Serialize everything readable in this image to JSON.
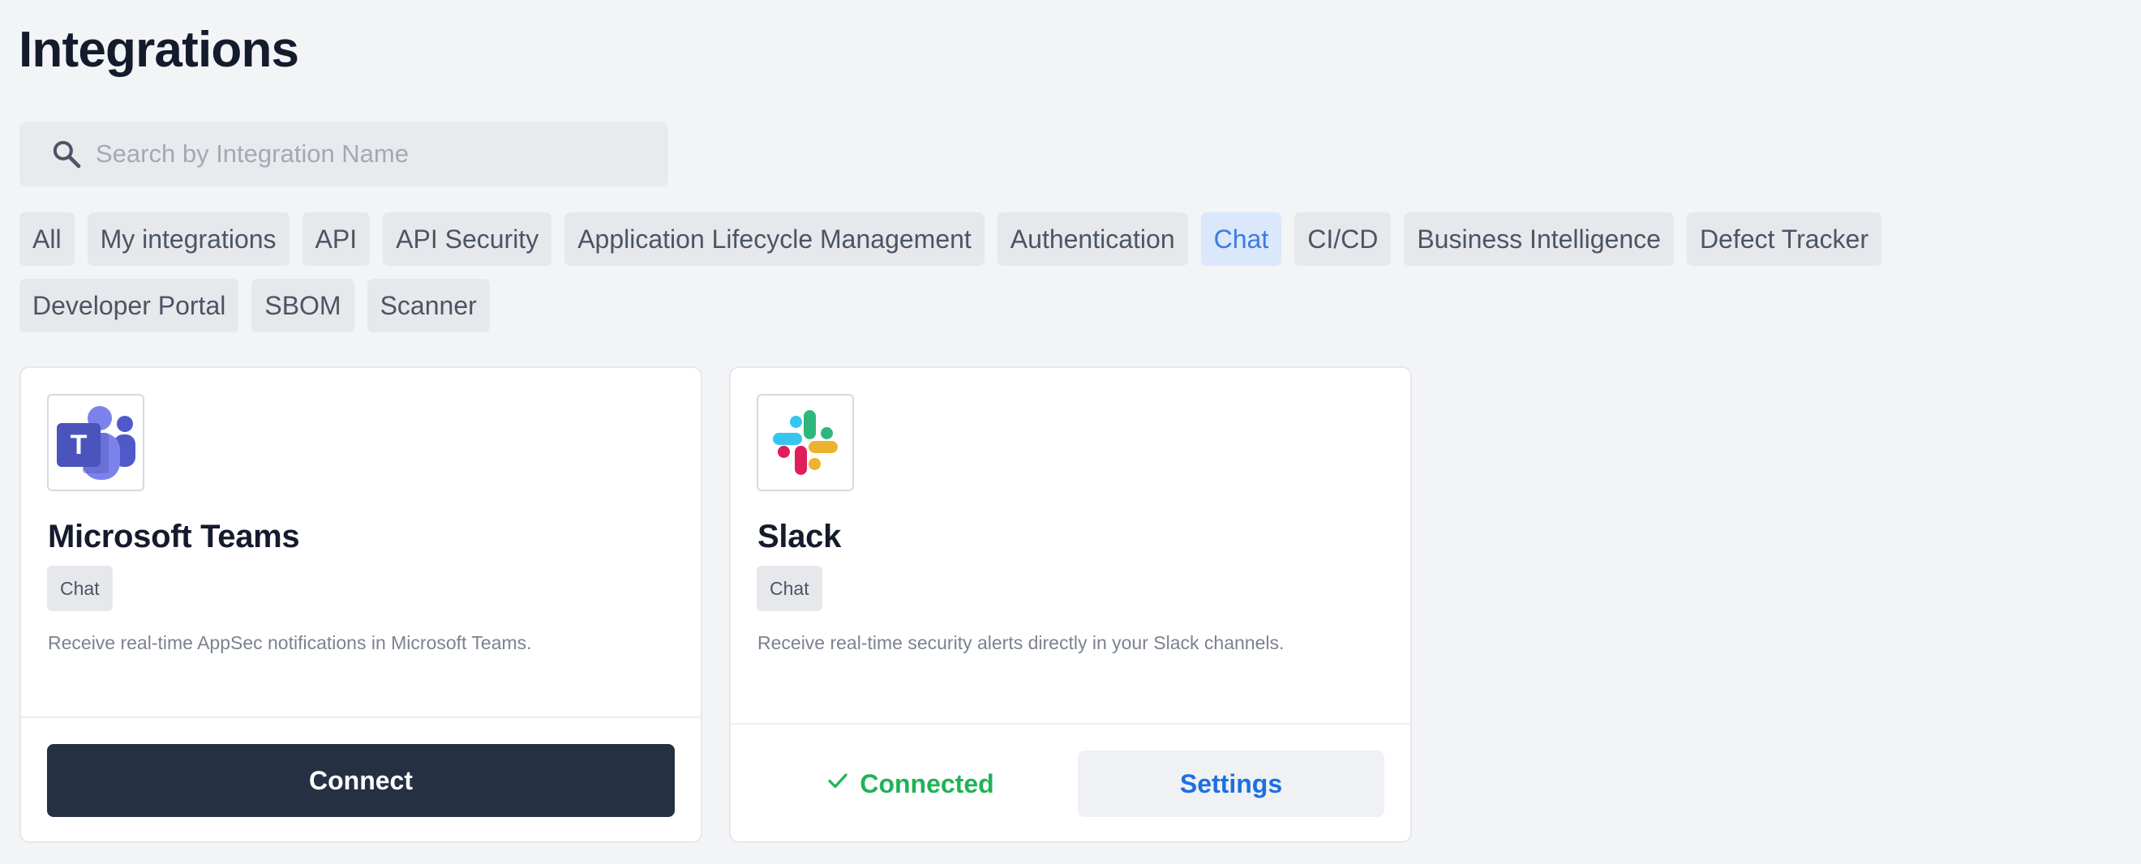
{
  "page": {
    "title": "Integrations"
  },
  "search": {
    "placeholder": "Search by Integration Name",
    "value": ""
  },
  "filters": {
    "row1": [
      "All",
      "My integrations",
      "API",
      "API Security",
      "Application Lifecycle Management",
      "Authentication",
      "Chat",
      "CI/CD",
      "Business Intelligence",
      "Defect Tracker"
    ],
    "row2": [
      "Developer Portal",
      "SBOM",
      "Scanner"
    ],
    "active": "Chat"
  },
  "cards": [
    {
      "name": "Microsoft Teams",
      "tag": "Chat",
      "description": "Receive real-time AppSec notifications in Microsoft Teams.",
      "action_label": "Connect",
      "logo_icon": "microsoft-teams-logo"
    },
    {
      "name": "Slack",
      "tag": "Chat",
      "description": "Receive real-time security alerts directly in your Slack channels.",
      "status_label": "Connected",
      "settings_label": "Settings",
      "logo_icon": "slack-logo"
    }
  ],
  "colors": {
    "accent": "#1c6fe0",
    "connected": "#1fb356",
    "primary_button": "#253142",
    "active_chip_bg": "#dbe7fb"
  }
}
